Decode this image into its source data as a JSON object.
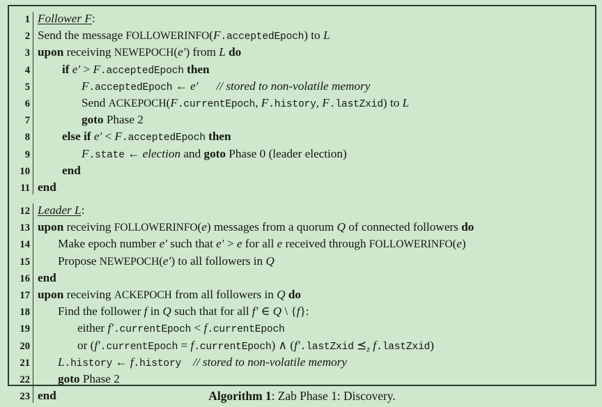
{
  "figure": {
    "caption_name": "Algorithm 1",
    "caption_text": ": Zab Phase 1: Discovery.",
    "background_color": "#cee7cd",
    "border_color": "#2c3a2b",
    "text_color": "#16170f"
  },
  "blocks": [
    {
      "role": "follower",
      "lines": [
        {
          "n": "1",
          "indent": 0,
          "text": "Follower F:"
        },
        {
          "n": "2",
          "indent": 0,
          "text": "Send the message FOLLOWERINFO(F.acceptedEpoch) to L"
        },
        {
          "n": "3",
          "indent": 0,
          "text": "upon receiving NEWEPOCH(e′) from L do"
        },
        {
          "n": "4",
          "indent": 1,
          "text": "if e′ > F.acceptedEpoch then"
        },
        {
          "n": "5",
          "indent": 2,
          "text": "F.acceptedEpoch ← e′     // stored to non-volatile memory"
        },
        {
          "n": "6",
          "indent": 2,
          "text": "Send ACKEPOCH(F.currentEpoch, F.history, F.lastZxid) to L"
        },
        {
          "n": "7",
          "indent": 2,
          "text": "goto Phase 2"
        },
        {
          "n": "8",
          "indent": 1,
          "text": "else if e′ < F.acceptedEpoch then"
        },
        {
          "n": "9",
          "indent": 2,
          "text": "F.state ← election and goto Phase 0 (leader election)"
        },
        {
          "n": "10",
          "indent": 1,
          "text": "end"
        },
        {
          "n": "11",
          "indent": 0,
          "text": "end"
        }
      ]
    },
    {
      "role": "leader",
      "lines": [
        {
          "n": "12",
          "indent": 0,
          "text": "Leader L:"
        },
        {
          "n": "13",
          "indent": 0,
          "text": "upon receiving FOLLOWERINFO(e) messages from a quorum Q of connected followers do"
        },
        {
          "n": "14",
          "indent": 1,
          "text": "Make epoch number e′ such that e′ > e for all e received through FOLLOWERINFO(e)"
        },
        {
          "n": "15",
          "indent": 1,
          "text": "Propose NEWEPOCH(e′) to all followers in Q"
        },
        {
          "n": "16",
          "indent": 0,
          "text": "end"
        },
        {
          "n": "17",
          "indent": 0,
          "text": "upon receiving ACKEPOCH from all followers in Q do"
        },
        {
          "n": "18",
          "indent": 1,
          "text": "Find the follower f in Q such that for all f′ ∈ Q \\ {f}:"
        },
        {
          "n": "19",
          "indent": 2,
          "text": "either f′.currentEpoch < f.currentEpoch"
        },
        {
          "n": "20",
          "indent": 2,
          "text": "or (f′.currentEpoch = f.currentEpoch) ∧ (f′.lastZxid ⪯z f.lastZxid)"
        },
        {
          "n": "21",
          "indent": 1,
          "text": "L.history ← f.history     // stored to non-volatile memory"
        },
        {
          "n": "22",
          "indent": 1,
          "text": "goto Phase 2"
        },
        {
          "n": "23",
          "indent": 0,
          "text": "end"
        }
      ]
    }
  ],
  "line_numbers": {
    "l1": "1",
    "l2": "2",
    "l3": "3",
    "l4": "4",
    "l5": "5",
    "l6": "6",
    "l7": "7",
    "l8": "8",
    "l9": "9",
    "l10": "10",
    "l11": "11",
    "l12": "12",
    "l13": "13",
    "l14": "14",
    "l15": "15",
    "l16": "16",
    "l17": "17",
    "l18": "18",
    "l19": "19",
    "l20": "20",
    "l21": "21",
    "l22": "22",
    "l23": "23"
  },
  "tokens": {
    "follower_hdr": "Follower",
    "leader_hdr": "Leader",
    "F": "F",
    "L": "L",
    "Q": "Q",
    "e": "e",
    "eprime": "e′",
    "f": "f",
    "fprime": "f′",
    "colon": ":",
    "send_the_message": "Send the message",
    "FOLLOWERINFO": "FOLLOWERINFO",
    "NEWEPOCH": "NEWEPOCH",
    "ACKEPOCH": "ACKEPOCH",
    "acceptedEpoch": ".acceptedEpoch",
    "currentEpoch": ".currentEpoch",
    "history": ".history",
    "lastZxid": ".lastZxid",
    "state": ".state",
    "to": "to",
    "upon": "upon",
    "receiving": "receiving",
    "from": "from",
    "do": "do",
    "if": "if",
    "then": "then",
    "else_if": "else if",
    "gt": ">",
    "lt": "<",
    "eq": "=",
    "larrow": "←",
    "and": "and",
    "goto": "goto",
    "phase2": "Phase 2",
    "phase0": "Phase 0 (leader election)",
    "election": "election",
    "end": "end",
    "comment_nonvolatile": "// stored to non-volatile memory",
    "messages_from_quorum": "messages from a quorum",
    "of_connected_followers": "of connected followers",
    "make_epoch_number": "Make epoch number",
    "such_that": "such that",
    "for_all": "for all",
    "received_through": "received through",
    "propose": "Propose",
    "to_all_followers_in": "to all followers in",
    "from_all_followers_in": "from all followers in",
    "find_the_follower": "Find the follower",
    "in": "in",
    "such_that_for_all": "such that for all",
    "in_set": "∈",
    "setminus": "\\",
    "lbrace": "{",
    "rbrace": "}",
    "either": "either",
    "or": "or",
    "wedge": "∧",
    "preceq_z": "⪯",
    "z_sub": "z",
    "lparen": "(",
    "rparen": ")"
  }
}
